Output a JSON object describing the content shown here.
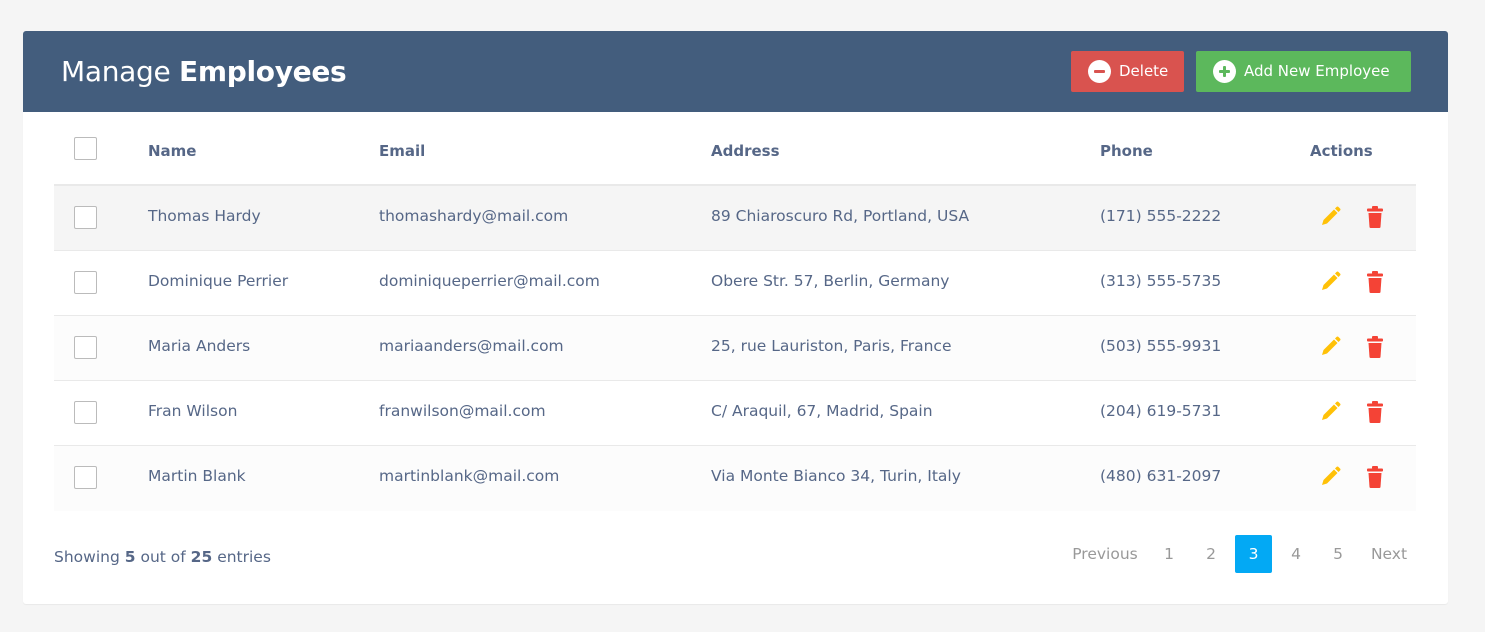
{
  "header": {
    "title_light": "Manage",
    "title_bold": "Employees",
    "delete_label": "Delete",
    "add_label": "Add New Employee",
    "header_color": "#435d7d",
    "delete_color": "#d9534f",
    "add_color": "#5cb85c"
  },
  "table": {
    "columns": [
      "Name",
      "Email",
      "Address",
      "Phone",
      "Actions"
    ],
    "rows": [
      {
        "name": "Thomas Hardy",
        "email": "thomashardy@mail.com",
        "address": "89 Chiaroscuro Rd, Portland, USA",
        "phone": "(171) 555-2222"
      },
      {
        "name": "Dominique Perrier",
        "email": "dominiqueperrier@mail.com",
        "address": "Obere Str. 57, Berlin, Germany",
        "phone": "(313) 555-5735"
      },
      {
        "name": "Maria Anders",
        "email": "mariaanders@mail.com",
        "address": "25, rue Lauriston, Paris, France",
        "phone": "(503) 555-9931"
      },
      {
        "name": "Fran Wilson",
        "email": "franwilson@mail.com",
        "address": "C/ Araquil, 67, Madrid, Spain",
        "phone": "(204) 619-5731"
      },
      {
        "name": "Martin Blank",
        "email": "martinblank@mail.com",
        "address": "Via Monte Bianco 34, Turin, Italy",
        "phone": "(480) 631-2097"
      }
    ],
    "edit_icon": "pencil-icon",
    "delete_icon": "trash-icon",
    "edit_color": "#ffc107",
    "delete_color": "#f44336"
  },
  "footer": {
    "showing_prefix": "Showing",
    "showing_count": "5",
    "showing_mid": "out of",
    "showing_total": "25",
    "showing_suffix": "entries"
  },
  "pagination": {
    "previous": "Previous",
    "pages": [
      "1",
      "2",
      "3",
      "4",
      "5"
    ],
    "active_page": "3",
    "next": "Next",
    "active_color": "#03a9f4"
  }
}
